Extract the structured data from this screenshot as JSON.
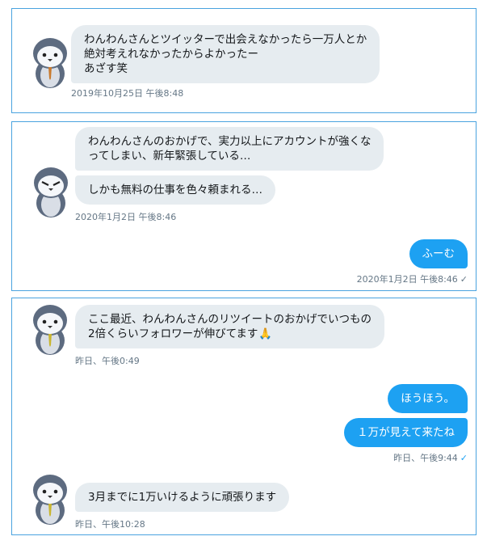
{
  "colors": {
    "panel_border": "#4aa3df",
    "incoming_bubble": "#e6ecf0",
    "outgoing_bubble": "#1da1f2",
    "timestamp": "#657786",
    "avatar_body": "#5d6b80",
    "avatar_face": "#f5f7fa",
    "tie_orange": "#c97a2e",
    "tie_yellow": "#c9b52e"
  },
  "panels": [
    {
      "messages": [
        {
          "direction": "in",
          "lines": [
            "わんわんさんとツイッターで出会えなかったら一万人とか",
            "絶対考えれなかったからよかったー",
            "あざす笑"
          ]
        }
      ],
      "timestamp": "2019年10月25日 午後8:48"
    },
    {
      "messages": [
        {
          "direction": "in",
          "lines": [
            "わんわんさんのおかげで、実力以上にアカウントが強くな",
            "ってしまい、新年緊張している…"
          ]
        },
        {
          "direction": "in",
          "lines": [
            "しかも無料の仕事を色々頼まれる…"
          ]
        }
      ],
      "timestamp_in": "2020年1月2日 午後8:46",
      "reply": {
        "direction": "out",
        "text": "ふーむ"
      },
      "timestamp_out": "2020年1月2日 午後8:46",
      "read_icon": "checkmark-icon"
    },
    {
      "messages": [
        {
          "direction": "in",
          "lines": [
            "ここ最近、わんわんさんのリツイートのおかげでいつもの",
            "2倍くらいフォロワーが伸びてます"
          ],
          "emoji": "🙏"
        }
      ],
      "timestamp_in": "昨日、午後0:49",
      "replies": [
        {
          "direction": "out",
          "text": "ほうほう。"
        },
        {
          "direction": "out",
          "text": "１万が見えて来たね"
        }
      ],
      "timestamp_out": "昨日、午後9:44",
      "read_icon": "checkmark-icon",
      "last_message": {
        "direction": "in",
        "text": "3月までに1万いけるように頑張ります"
      },
      "timestamp_last": "昨日、午後10:28"
    }
  ]
}
